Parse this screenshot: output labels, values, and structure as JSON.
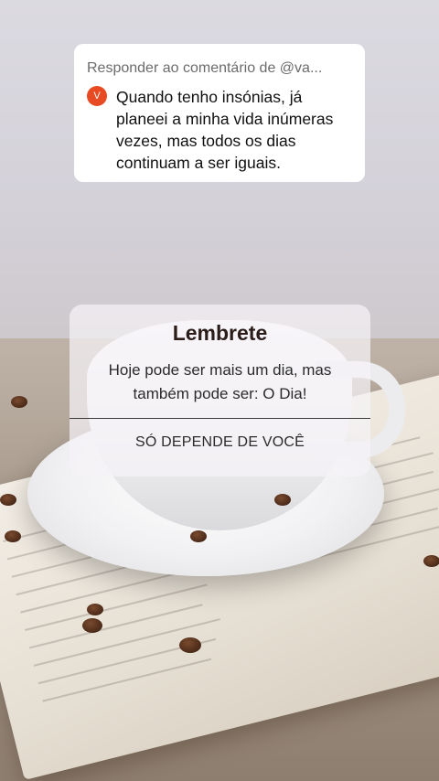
{
  "comment": {
    "header": "Responder ao comentário de @va...",
    "avatar_letter": "V",
    "text": "Quando tenho  insónias, já\nplaneei a minha vida inúmeras\nvezes, mas todos os dias\ncontinuam  a ser iguais."
  },
  "reminder": {
    "title": "Lembrete",
    "text": "Hoje pode ser mais um dia, mas\ntambém pode ser: O Dia!",
    "footer": "SÓ DEPENDE DE VOCÊ"
  },
  "colors": {
    "avatar": "#e84a24",
    "title": "#2b1d1a"
  }
}
